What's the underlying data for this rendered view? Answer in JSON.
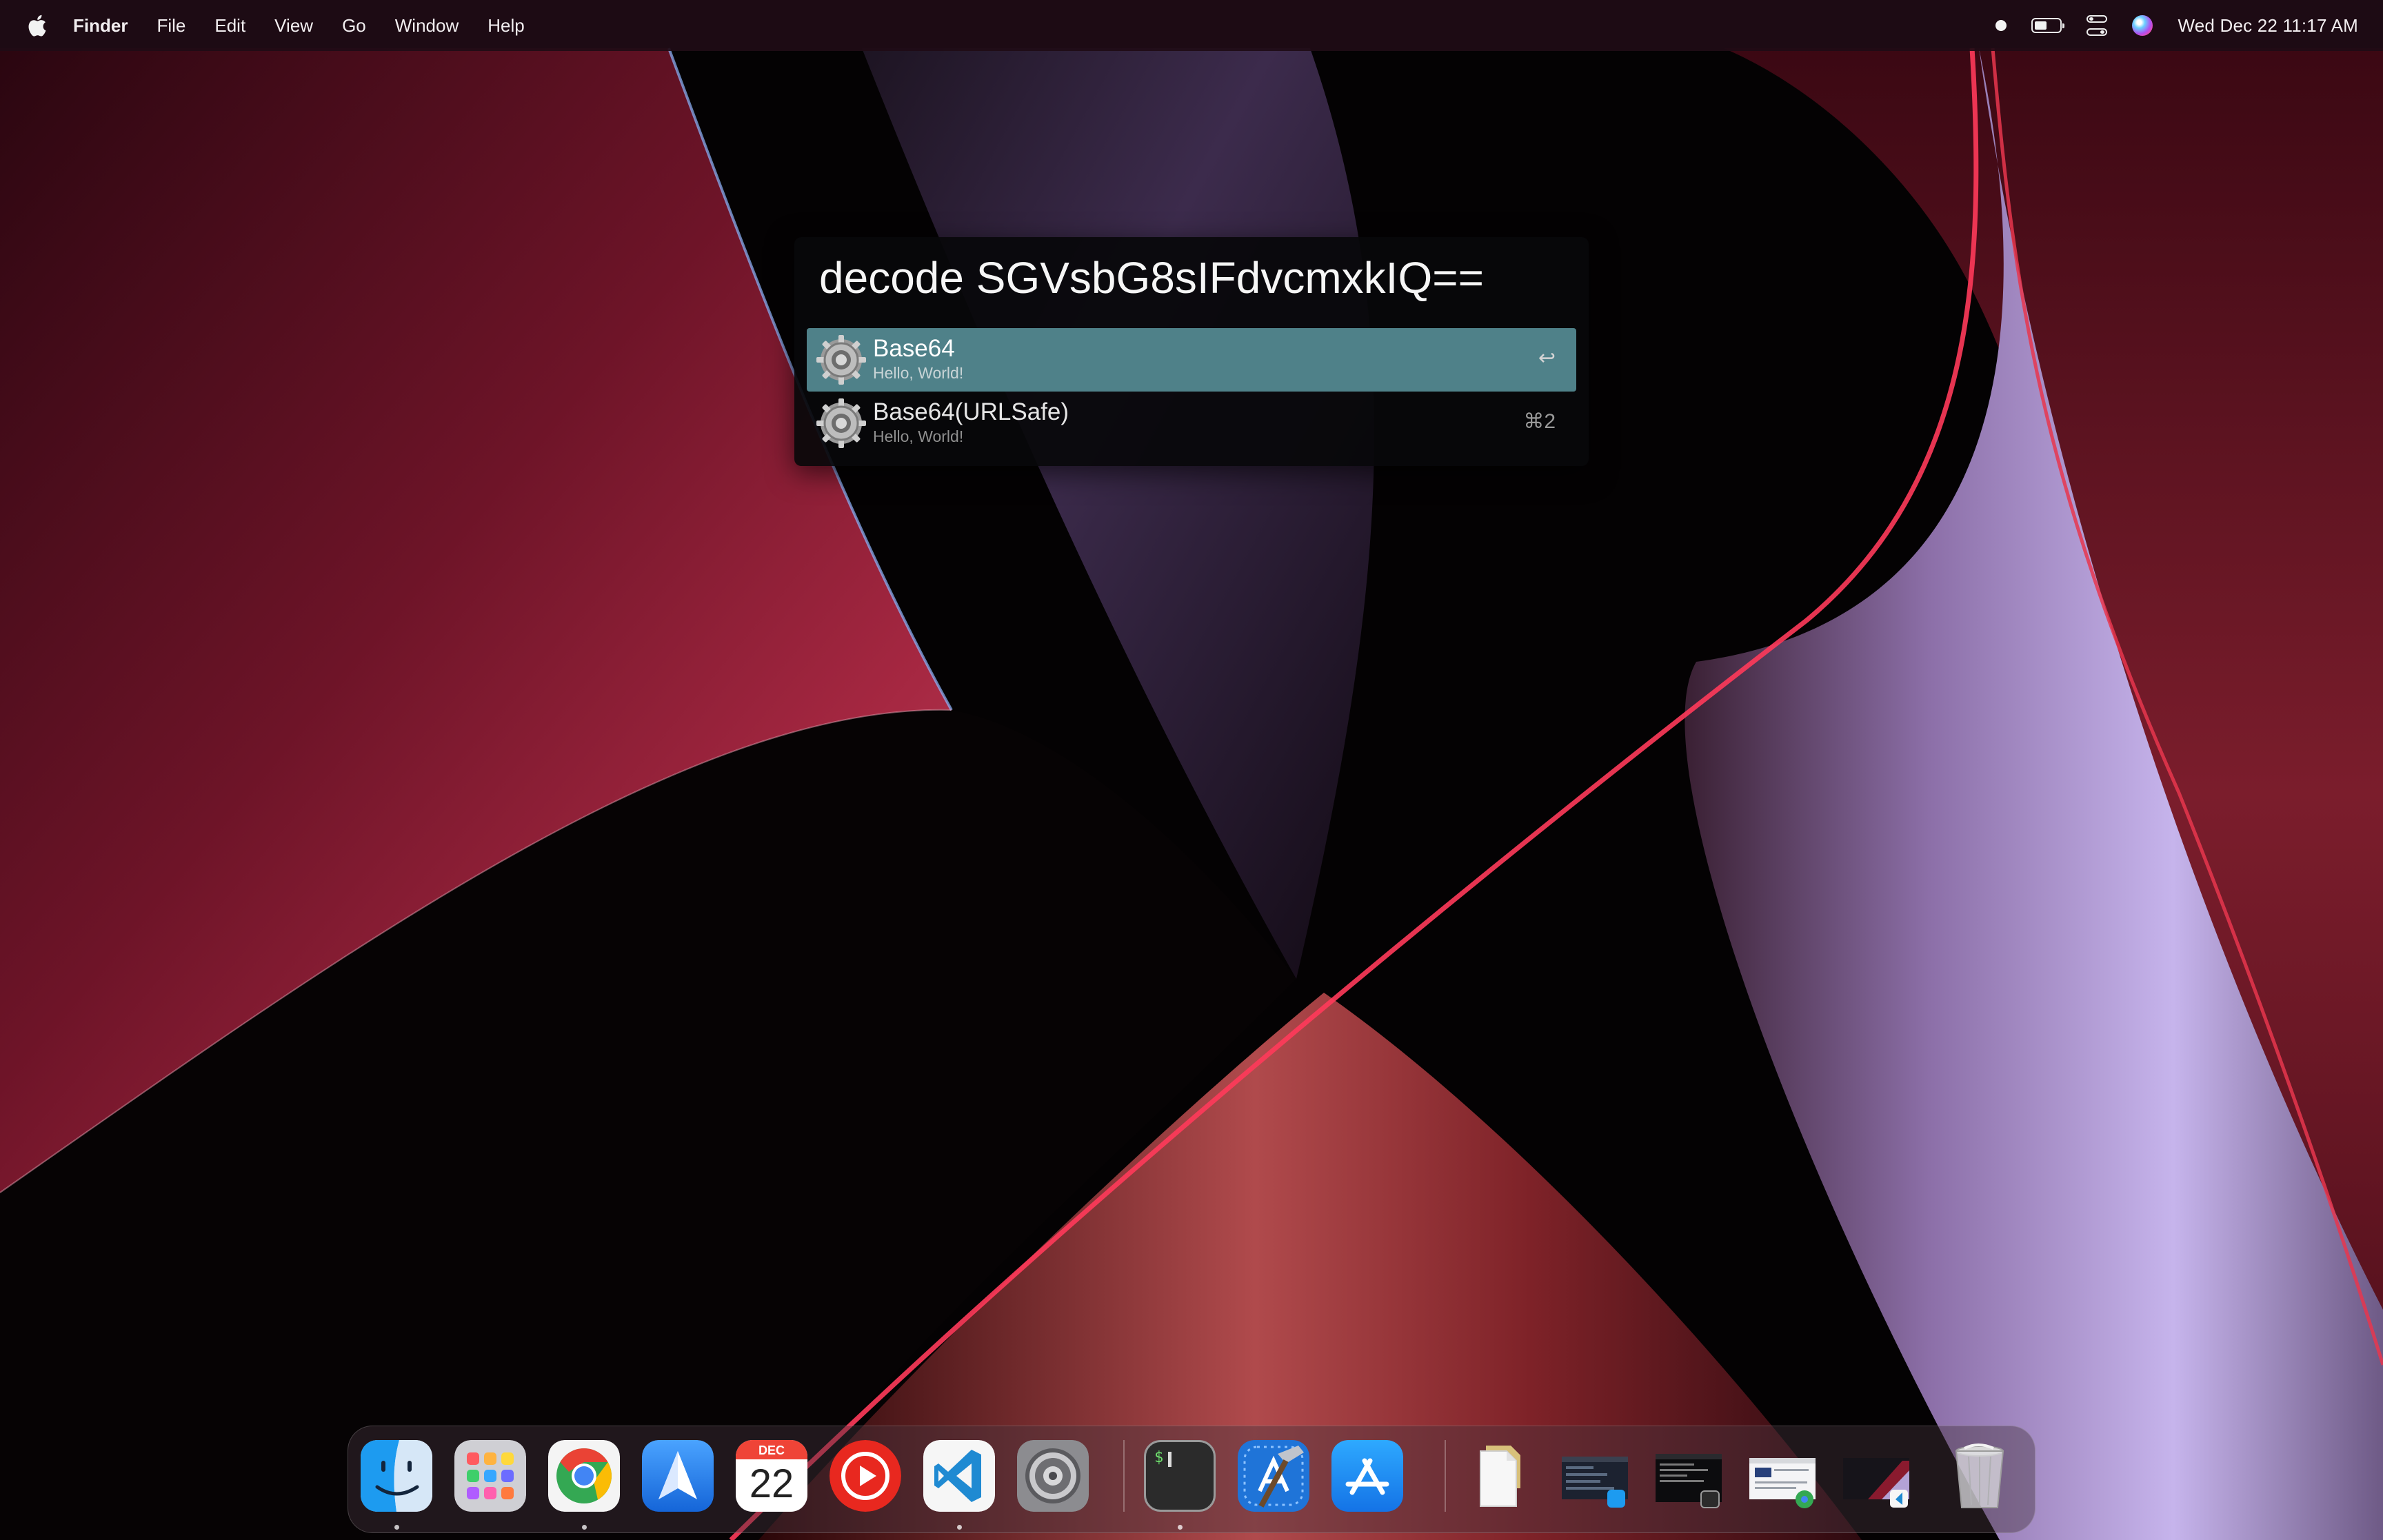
{
  "menubar": {
    "apple_icon": "apple-logo",
    "app_name": "Finder",
    "items": [
      "File",
      "Edit",
      "View",
      "Go",
      "Window",
      "Help"
    ],
    "battery_level": 0.5,
    "clock": "Wed Dec 22  11:17 AM"
  },
  "launcher": {
    "query": "decode SGVsbG8sIFdvcmxkIQ==",
    "results": [
      {
        "title": "Base64",
        "subtitle": "Hello, World!",
        "shortcut": "↩",
        "selected": true,
        "icon": "gear-icon"
      },
      {
        "title": "Base64(URLSafe)",
        "subtitle": "Hello, World!",
        "shortcut": "⌘2",
        "selected": false,
        "icon": "gear-icon"
      }
    ]
  },
  "dock": {
    "apps": [
      {
        "name": "Finder",
        "icon": "finder-icon",
        "running": true
      },
      {
        "name": "Launchpad",
        "icon": "launchpad-icon",
        "running": false
      },
      {
        "name": "Google Chrome",
        "icon": "chrome-icon",
        "running": true
      },
      {
        "name": "Spark",
        "icon": "spark-icon",
        "running": false
      },
      {
        "name": "Calendar",
        "icon": "calendar-icon",
        "running": false,
        "month": "DEC",
        "day": "22"
      },
      {
        "name": "YouTube Music",
        "icon": "play-icon",
        "running": false
      },
      {
        "name": "Visual Studio Code",
        "icon": "vscode-icon",
        "running": true
      },
      {
        "name": "System Preferences",
        "icon": "system-preferences-icon",
        "running": false
      },
      {
        "name": "Terminal",
        "icon": "terminal-icon",
        "running": true,
        "prompt": "$"
      },
      {
        "name": "Xcode",
        "icon": "xcode-icon",
        "running": false
      },
      {
        "name": "App Store",
        "icon": "app-store-icon",
        "running": false
      }
    ],
    "documents": [
      {
        "name": "Downloads",
        "icon": "document-stack-icon"
      },
      {
        "name": "Finder window",
        "icon": "minimized-window-thumbnail"
      },
      {
        "name": "Terminal window",
        "icon": "minimized-window-thumbnail"
      },
      {
        "name": "Chrome window",
        "icon": "minimized-window-thumbnail"
      },
      {
        "name": "VS Code window",
        "icon": "minimized-window-thumbnail"
      },
      {
        "name": "Trash",
        "icon": "trash-icon"
      }
    ]
  }
}
